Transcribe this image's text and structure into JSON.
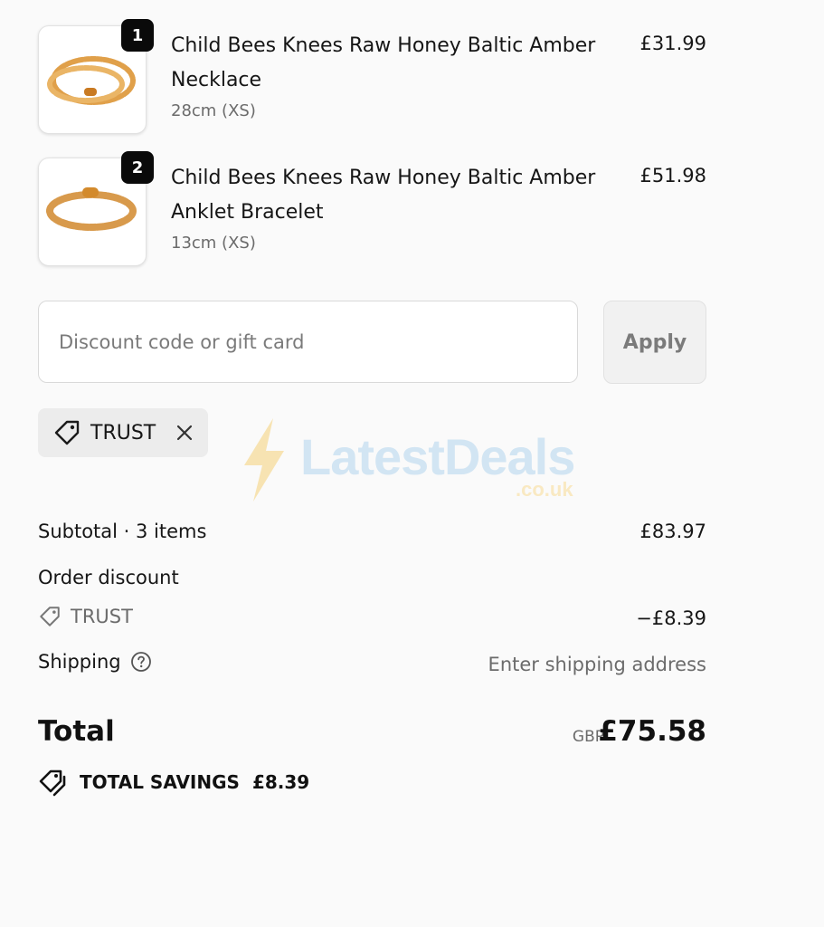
{
  "items": [
    {
      "quantity": "1",
      "name": "Child Bees Knees Raw Honey Baltic Amber Necklace",
      "variant": "28cm (XS)",
      "price": "£31.99",
      "image": "amber-necklace-image"
    },
    {
      "quantity": "2",
      "name": "Child Bees Knees Raw Honey Baltic Amber Anklet Bracelet",
      "variant": "13cm (XS)",
      "price": "£51.98",
      "image": "amber-anklet-image"
    }
  ],
  "discount": {
    "placeholder": "Discount code or gift card",
    "value": "",
    "apply_label": "Apply",
    "applied_code": "TRUST"
  },
  "watermark": {
    "brand": "LatestDeals",
    "tld": ".co.uk"
  },
  "summary": {
    "subtotal_label": "Subtotal · 3 items",
    "subtotal_value": "£83.97",
    "order_discount_label": "Order discount",
    "discount_code": "TRUST",
    "discount_value": "−£8.39",
    "shipping_label": "Shipping",
    "shipping_value": "Enter shipping address",
    "total_label": "Total",
    "currency": "GBP",
    "total_value": "£75.58",
    "savings_label": "TOTAL SAVINGS",
    "savings_value": "£8.39"
  },
  "colors": {
    "badge": "#0a0a0a",
    "amber": "#e0a04a",
    "chip": "#ececec"
  }
}
